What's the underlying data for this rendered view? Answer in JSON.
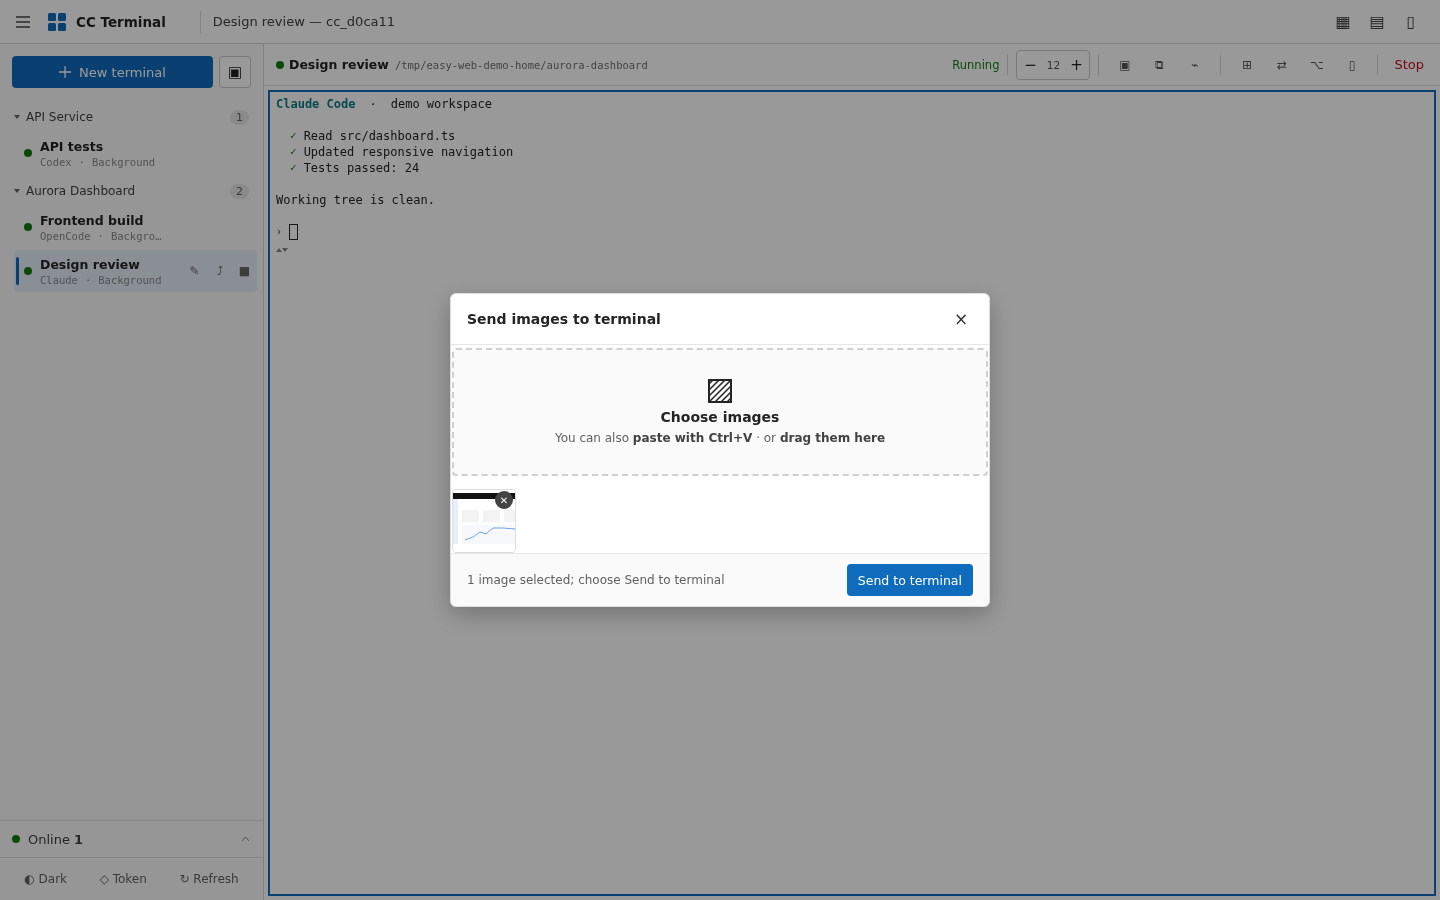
{
  "topbar": {
    "app_name": "CC Terminal",
    "window_title": "Design review — cc_d0ca11",
    "layout_buttons": [
      "▦",
      "▤",
      "▯"
    ]
  },
  "sidebar": {
    "new_button": "New terminal",
    "side_button": "▣",
    "groups": [
      {
        "name": "API Service",
        "count": "1",
        "expanded": true,
        "items": [
          {
            "title": "API tests",
            "agent": "Codex",
            "sep": "·",
            "mode": "Background",
            "selected": false
          }
        ]
      },
      {
        "name": "Aurora Dashboard",
        "count": "2",
        "expanded": true,
        "items": [
          {
            "title": "Frontend build",
            "agent": "OpenCode",
            "sep": "·",
            "mode": "Backgro…",
            "selected": false
          },
          {
            "title": "Design review",
            "agent": "Claude",
            "sep": "·",
            "mode": "Background",
            "selected": true,
            "actions": [
              "✎",
              "⤴",
              "■"
            ]
          }
        ]
      }
    ],
    "online": {
      "text": "Online **1**",
      "expanded": false
    },
    "footer_buttons": [
      "◐ Dark",
      "◇ Token",
      "↻ Refresh"
    ]
  },
  "session": {
    "title": "Design review",
    "path": "/tmp/easy-web-demo-home/aurora-dashboard",
    "status": "Running",
    "font_minus": "−",
    "font_size": "12",
    "font_plus": "+",
    "tool_groups": [
      [
        "▣",
        "⧉",
        "⌁"
      ],
      [
        "⊞",
        "⇄",
        "⌥",
        "▯"
      ]
    ],
    "stop": "Stop"
  },
  "terminal": {
    "lines": [
      {
        "kind": "header",
        "app": "Claude Code",
        "sep": "·",
        "text": "demo workspace"
      },
      {
        "kind": "blank"
      },
      {
        "kind": "check",
        "mark": "✓",
        "text": "Read src/dashboard.ts"
      },
      {
        "kind": "check",
        "mark": "✓",
        "text": "Updated responsive navigation"
      },
      {
        "kind": "check",
        "mark": "✓",
        "text": "Tests passed: 24"
      },
      {
        "kind": "blank"
      },
      {
        "kind": "text",
        "text": "Working tree is clean."
      },
      {
        "kind": "blank"
      },
      {
        "kind": "prompt",
        "mark": "›"
      }
    ]
  },
  "dialog": {
    "title": "Send images to terminal",
    "close": "×",
    "drop_title": "Choose images",
    "drop_hint": "You can also **paste with Ctrl+V** · or **drag them here**",
    "images": [
      {
        "kind": "picture",
        "remove": "✕"
      }
    ],
    "status": "1 image selected; choose Send to terminal",
    "send": "Send to terminal"
  }
}
